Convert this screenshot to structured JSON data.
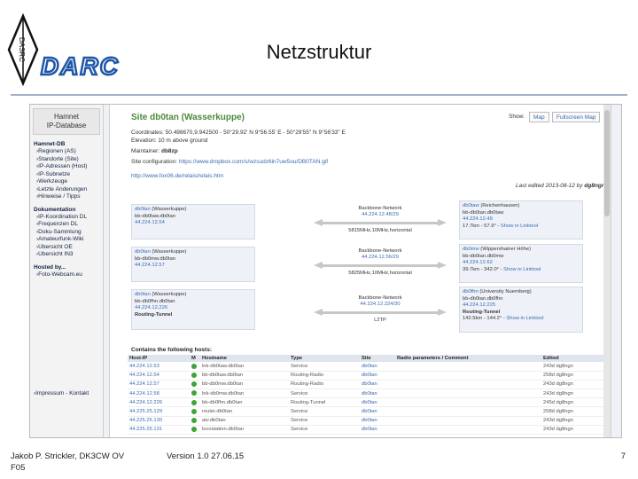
{
  "slide": {
    "title": "Netzstruktur",
    "logo_text": "DARC",
    "logo_diamond": "DASRC",
    "footer_left_line1": "Jakob P. Strickler, DK3CW OV",
    "footer_left_line2": "F05",
    "footer_center": "Version 1.0 27.06.15",
    "footer_right": "7"
  },
  "sidebar": {
    "header_line1": "Hamnet",
    "header_line2": "IP-Database",
    "sections": [
      {
        "title": "Hamnet-DB",
        "items": [
          "Regionen (AS)",
          "Standorte (Site)",
          "IP-Adressen (Host)",
          "IP-Subnetze",
          "Werkzeuge",
          "Letzte Änderungen",
          "Hinweise / Tipps"
        ]
      },
      {
        "title": "Dokumentation",
        "items": [
          "IP-Koordination DL",
          "Frequenzen DL",
          "Doku-Sammlung",
          "Amateurfunk-Wiki",
          "Übersicht OE",
          "Übersicht IN3"
        ]
      },
      {
        "title": "Hosted by...",
        "items": [
          "Foto-Webcam.eu"
        ]
      }
    ],
    "footer_link": "Impressum - Kontakt"
  },
  "site": {
    "title": "Site db0tan (Wasserkuppe)",
    "show_label": "Show:",
    "map_btn": "Map",
    "fullscreen_btn": "Fullscreen Map",
    "coordinates": "Coordinates: 50.498670,9.942500  -  50°29.92' N 9°56.55' E  -  50°29'55\" N 9°56'33\" E",
    "elevation": "Elevation: 10 m above ground",
    "maintainer_label": "Maintainer: ",
    "maintainer": "db8zp",
    "config_label": "Site configuration: ",
    "config_url": "https://www.dropbox.com/s/wzsudz6in7uw5ou/DB0TAN.gif",
    "link_url": "http://www.fox06.de/relais/relais.htm",
    "edited_label": "Last edited 2013-08-12 by ",
    "edited_by": "dg8ngn"
  },
  "links": [
    {
      "left": {
        "name": "db0tan",
        "site": " (Wasserkuppe)",
        "host": "bb-db0taw.db0tan",
        "ip": "44.224.12.54"
      },
      "middle": {
        "label": "Backbone-Network",
        "ip": "44.224.12.48/29",
        "info": "5815MHz,10MHz,horizontal"
      },
      "right": {
        "name": "db0taw",
        "site": " (Reichenhausen)",
        "host": "bb-db0tan.db0taw",
        "ip": "44.224.12.49",
        "info": "17.7km - 57.9° - ",
        "linktool": "Show in Linktool"
      }
    },
    {
      "left": {
        "name": "db0tan",
        "site": " (Wasserkuppe)",
        "host": "bb-db0mw.db0tan",
        "ip": "44.224.12.57"
      },
      "middle": {
        "label": "Backbone-Network",
        "ip": "44.224.12.56/29",
        "info": "5825MHz,10MHz,horizontal"
      },
      "right": {
        "name": "db0mw",
        "site": " (Wippershainer Höhe)",
        "host": "bb-db0tan.db0mw",
        "ip": "44.224.12.62",
        "info": "39.7km - 342.0° - ",
        "linktool": "Show in Linktool"
      }
    },
    {
      "left": {
        "name": "db0tan",
        "site": " (Wasserkuppe)",
        "host": "bb-db0fhn.db0tan",
        "ip": "44.224.12.226",
        "extra": "Routing-Tunnel"
      },
      "middle": {
        "label": "Backbone-Network",
        "ip": "44.224.12.224/30",
        "info": "L2TP"
      },
      "right": {
        "name": "db0fhn",
        "site": " (University Nuernberg)",
        "host": "bb-db0tan.db0fhn",
        "ip": "44.224.12.225",
        "extra": "Routing-Tunnel",
        "info": "142.5km - 144.2° - ",
        "linktool": "Show in Linktool"
      }
    }
  ],
  "hosts": {
    "title": "Contains the following hosts:",
    "columns": [
      "Host-IP",
      "M",
      "Hostname",
      "Type",
      "Site",
      "Radio parameters / Comment",
      "Edited"
    ],
    "rows": [
      [
        "44.224.12.53",
        "lnk-db0taw.db0tan",
        "Service",
        "db0tan",
        "",
        "243d dg8ngn"
      ],
      [
        "44.224.12.54",
        "bb-db0taw.db0tan",
        "Routing-Radio",
        "db0tan",
        "",
        "258d dg8ngn"
      ],
      [
        "44.224.12.57",
        "bb-db0mw.db0tan",
        "Routing-Radio",
        "db0tan",
        "",
        "243d dg8ngn"
      ],
      [
        "44.224.12.58",
        "lnk-db0mw.db0tan",
        "Service",
        "db0tan",
        "",
        "243d dg8ngn"
      ],
      [
        "44.224.12.226",
        "bb-db0fhn.db0tan",
        "Routing-Tunnel",
        "db0tan",
        "",
        "245d dg8ngn"
      ],
      [
        "44.225.25.129",
        "router.db0tan",
        "Service",
        "db0tan",
        "",
        "258d dg8ngn"
      ],
      [
        "44.225.25.130",
        "atv.db0tan",
        "Service",
        "db0tan",
        "",
        "243d dg8ngn"
      ],
      [
        "44.225.25.131",
        "locostation.db0tan",
        "Service",
        "db0tan",
        "",
        "243d dg8ngn"
      ]
    ]
  },
  "colors": {
    "site_title": "#4d8a3a",
    "link": "#3a6ab0",
    "status_online": "#3fa33a",
    "logo_blue": "#1f56a8"
  }
}
